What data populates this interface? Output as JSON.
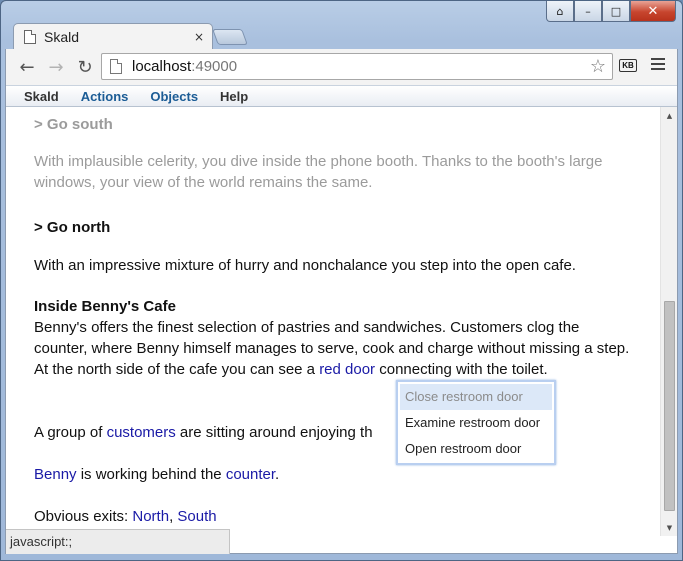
{
  "window": {
    "controls": {
      "user": "⌂",
      "minimize": "–",
      "maximize": "□",
      "close": "✕"
    }
  },
  "tab": {
    "title": "Skald",
    "close": "×"
  },
  "toolbar": {
    "back": "←",
    "forward": "→",
    "reload": "↻",
    "url_host": "localhost",
    "url_port": ":49000",
    "star": "☆",
    "kb_label": "KB"
  },
  "app_menu": {
    "brand": "Skald",
    "items": [
      "Actions",
      "Objects",
      "Help"
    ]
  },
  "transcript": {
    "prev_command": "> Go south",
    "prev_response": "With implausible celerity, you dive inside the phone booth.  Thanks to the booth's large windows, your view of the world remains the same.",
    "command": "> Go north",
    "response": "With an impressive mixture of hurry and nonchalance you step into the open cafe.",
    "room_title": "Inside Benny's Cafe",
    "room_desc_before": "Benny's offers the finest selection of pastries and sandwiches.  Customers clog the counter, where Benny himself manages to serve, cook and charge without missing a step.  At the north side of the cafe you can see a ",
    "room_desc_link": "red door",
    "room_desc_after": " connecting with the toilet.",
    "customers_before": "A group of ",
    "customers_link": "customers",
    "customers_after": " are sitting around enjoying th",
    "benny_link": "Benny",
    "benny_mid": " is working behind the ",
    "counter_link": "counter",
    "benny_end": ".",
    "exits_label": "Obvious exits: ",
    "exit_north": "North",
    "exit_sep": ", ",
    "exit_south": "South"
  },
  "context_menu": {
    "items": [
      {
        "label": "Close restroom door",
        "disabled": true
      },
      {
        "label": "Examine restroom door",
        "disabled": false
      },
      {
        "label": "Open restroom door",
        "disabled": false
      }
    ]
  },
  "scrollbar": {
    "up": "▲",
    "down": "▼"
  },
  "status": {
    "text": "javascript:;"
  }
}
